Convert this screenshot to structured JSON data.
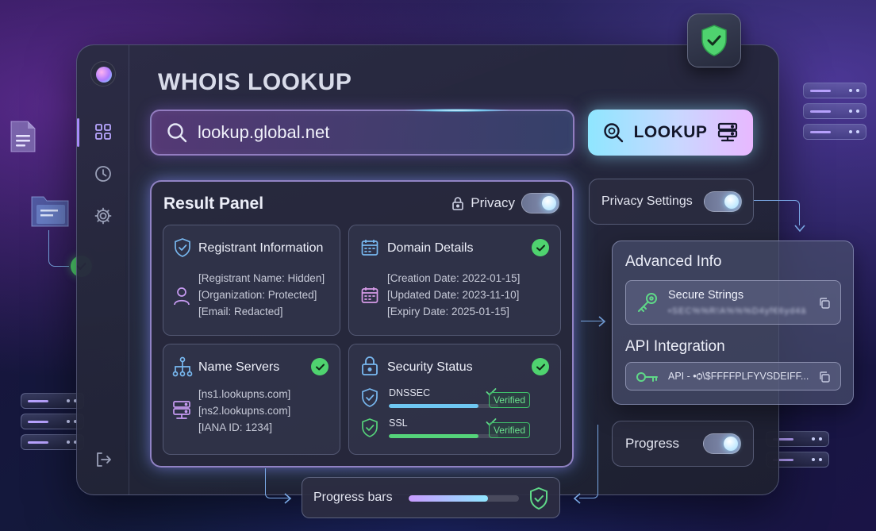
{
  "app": {
    "title": "WHOIS LOOKUP"
  },
  "sidebar": {
    "items": [
      {
        "icon": "dashboard-icon"
      },
      {
        "icon": "clock-icon"
      },
      {
        "icon": "gear-icon"
      },
      {
        "icon": "logout-icon"
      }
    ]
  },
  "search": {
    "value": "lookup.global.net",
    "button_label": "LOOKUP"
  },
  "result_panel": {
    "title": "Result Panel",
    "privacy_label": "Privacy",
    "privacy_on": true,
    "cards": {
      "registrant": {
        "title": "Registrant Information",
        "lines": [
          "[Registrant Name: Hidden]",
          "[Organization: Protected]",
          "[Email: Redacted]"
        ]
      },
      "domain": {
        "title": "Domain Details",
        "lines": [
          "[Creation Date: 2022-01-15]",
          "[Updated Date: 2023-11-10]",
          "[Expiry Date: 2025-01-15]"
        ]
      },
      "nameservers": {
        "title": "Name Servers",
        "lines": [
          "[ns1.lookupns.com]",
          "[ns2.lookupns.com]",
          "[IANA ID: 1234]"
        ]
      },
      "security": {
        "title": "Security Status",
        "items": [
          {
            "label": "DNSSEC",
            "badge": "Verified",
            "progress": 0.82,
            "color": "#6fc7f2"
          },
          {
            "label": "SSL",
            "badge": "Verified",
            "progress": 0.82,
            "color": "#55d37a"
          }
        ]
      }
    }
  },
  "privacy_settings": {
    "label": "Privacy Settings",
    "enabled": true
  },
  "advanced": {
    "title": "Advanced Info",
    "secure_label": "Secure Strings",
    "secure_value": "•SEC%%R!A%%%D4yf€6yd4ä",
    "api_title": "API Integration",
    "api_value": "API - •ѻ\\$FFFFPLFYVSDEIFF..."
  },
  "progress_setting": {
    "label": "Progress",
    "enabled": true
  },
  "progress_bars": {
    "label": "Progress bars",
    "progress": 0.72
  },
  "colors": {
    "accent_purple": "#a78bfa",
    "accent_cyan": "#8fe6ff",
    "success": "#4fd36f"
  }
}
